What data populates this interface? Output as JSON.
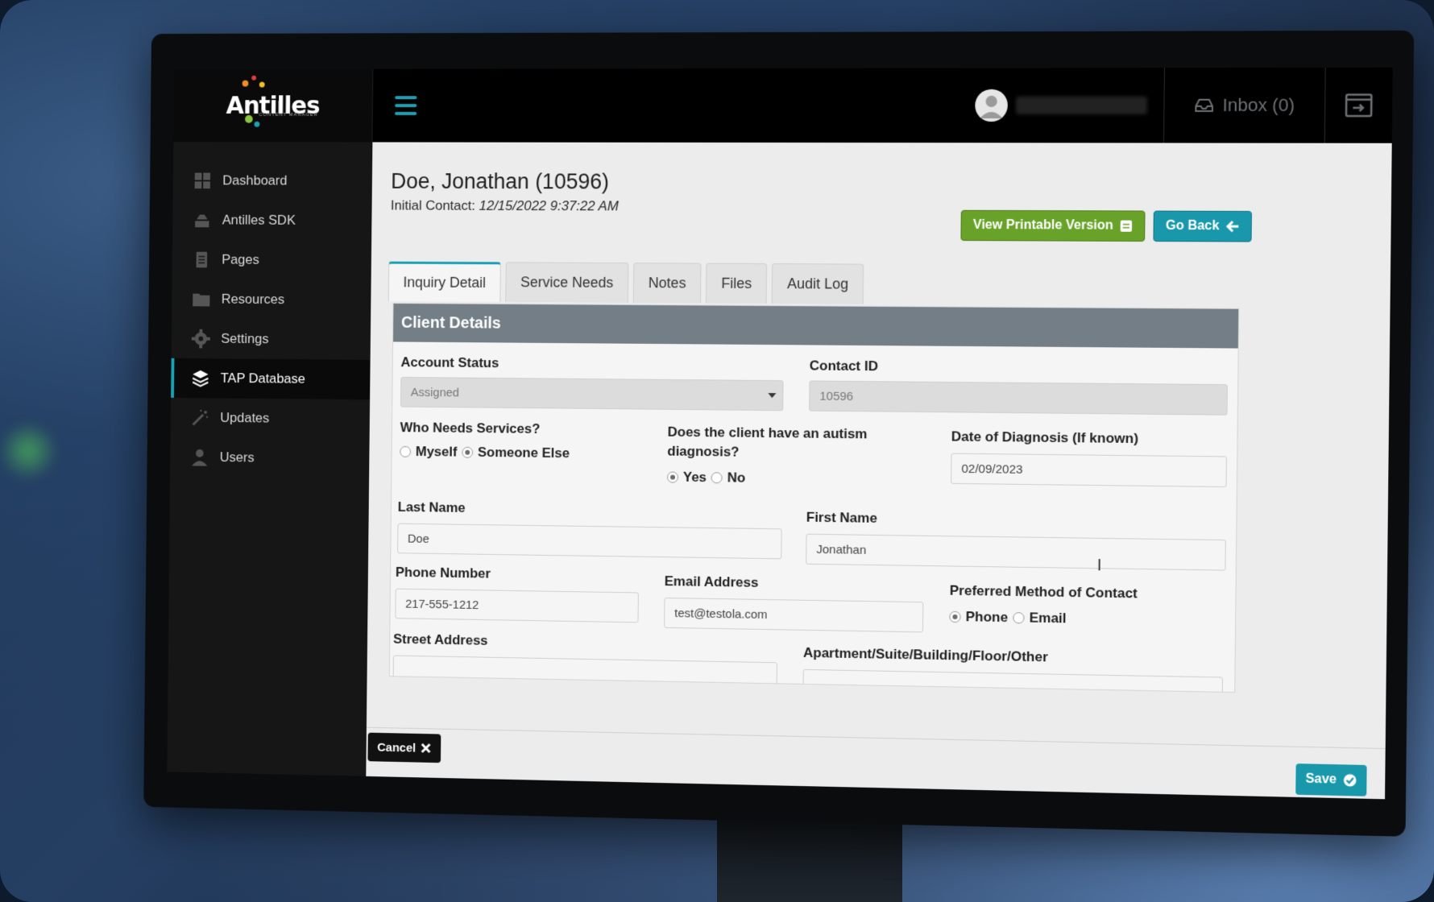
{
  "app": {
    "logo_text": "Antilles",
    "logo_subtitle": "CONTENT MANAGER"
  },
  "header": {
    "inbox_label": "Inbox (0)",
    "menu_icon": "hamburger-icon",
    "exit_icon": "exit-window-icon"
  },
  "sidebar": {
    "items": [
      {
        "label": "Dashboard",
        "icon": "dashboard-icon"
      },
      {
        "label": "Antilles SDK",
        "icon": "sdk-icon"
      },
      {
        "label": "Pages",
        "icon": "pages-icon"
      },
      {
        "label": "Resources",
        "icon": "folder-icon"
      },
      {
        "label": "Settings",
        "icon": "gear-icon"
      },
      {
        "label": "TAP Database",
        "icon": "layers-icon"
      },
      {
        "label": "Updates",
        "icon": "wand-icon"
      },
      {
        "label": "Users",
        "icon": "user-icon"
      }
    ],
    "active": "TAP Database"
  },
  "page": {
    "title": "Doe, Jonathan (10596)",
    "initial_contact_label": "Initial Contact:",
    "initial_contact_value": "12/15/2022 9:37:22 AM"
  },
  "actions": {
    "printable_label": "View Printable Version",
    "go_back_label": "Go Back"
  },
  "tabs": [
    "Inquiry Detail",
    "Service Needs",
    "Notes",
    "Files",
    "Audit Log"
  ],
  "panel": {
    "title": "Client Details",
    "account_status_label": "Account Status",
    "account_status_value": "Assigned",
    "contact_id_label": "Contact ID",
    "contact_id_value": "10596",
    "who_needs_label": "Who Needs Services?",
    "who_needs_options": [
      "Myself",
      "Someone Else"
    ],
    "who_needs_selected": "Someone Else",
    "autism_label": "Does the client have an autism diagnosis?",
    "autism_options": [
      "Yes",
      "No"
    ],
    "autism_selected": "Yes",
    "diagnosis_date_label": "Date of Diagnosis (If known)",
    "diagnosis_date_value": "02/09/2023",
    "last_name_label": "Last Name",
    "last_name_value": "Doe",
    "first_name_label": "First Name",
    "first_name_value": "Jonathan",
    "phone_label": "Phone Number",
    "phone_value": "217-555-1212",
    "email_label": "Email Address",
    "email_value": "test@testola.com",
    "contact_method_label": "Preferred Method of Contact",
    "contact_method_options": [
      "Phone",
      "Email"
    ],
    "contact_method_selected": "Phone",
    "street_label": "Street Address",
    "apartment_label": "Apartment/Suite/Building/Floor/Other"
  },
  "footer": {
    "cancel_label": "Cancel",
    "save_label": "Save"
  },
  "colors": {
    "accent": "#1998ab",
    "green": "#68a228",
    "panel_header": "#737e86"
  }
}
